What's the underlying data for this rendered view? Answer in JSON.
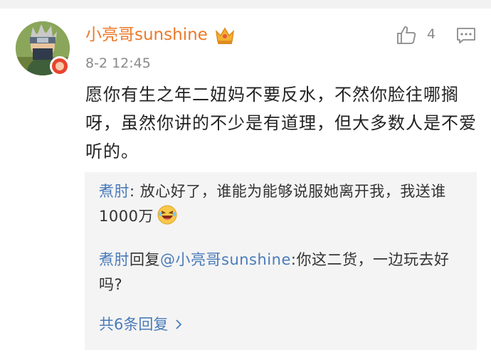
{
  "comment": {
    "username": "小亮哥sunshine",
    "timestamp": "8-2 12:45",
    "like_count": "4",
    "text": "愿你有生之年二妞妈不要反水，不然你脸往哪搁呀，虽然你讲的不少是有道理，但大多数人是不爱听的。",
    "icons": [
      "avatar",
      "verified-badge-icon",
      "crown-icon",
      "like-icon",
      "comment-icon"
    ],
    "colors": {
      "username": "#eb7a2b",
      "link": "#4a7bb9",
      "reply_bg": "#f4f4f4"
    }
  },
  "replies": [
    {
      "author": "煮肘",
      "separator": ": ",
      "text": "放心好了，谁能为能够说服她离开我，我送谁1000万",
      "emoji": "laughing-emoji-icon"
    },
    {
      "author": "煮肘",
      "reply_word": "回复",
      "mention": "@小亮哥sunshine",
      "separator": ":",
      "text": "你这二货，一边玩去好吗?"
    }
  ],
  "more_replies": "共6条回复"
}
